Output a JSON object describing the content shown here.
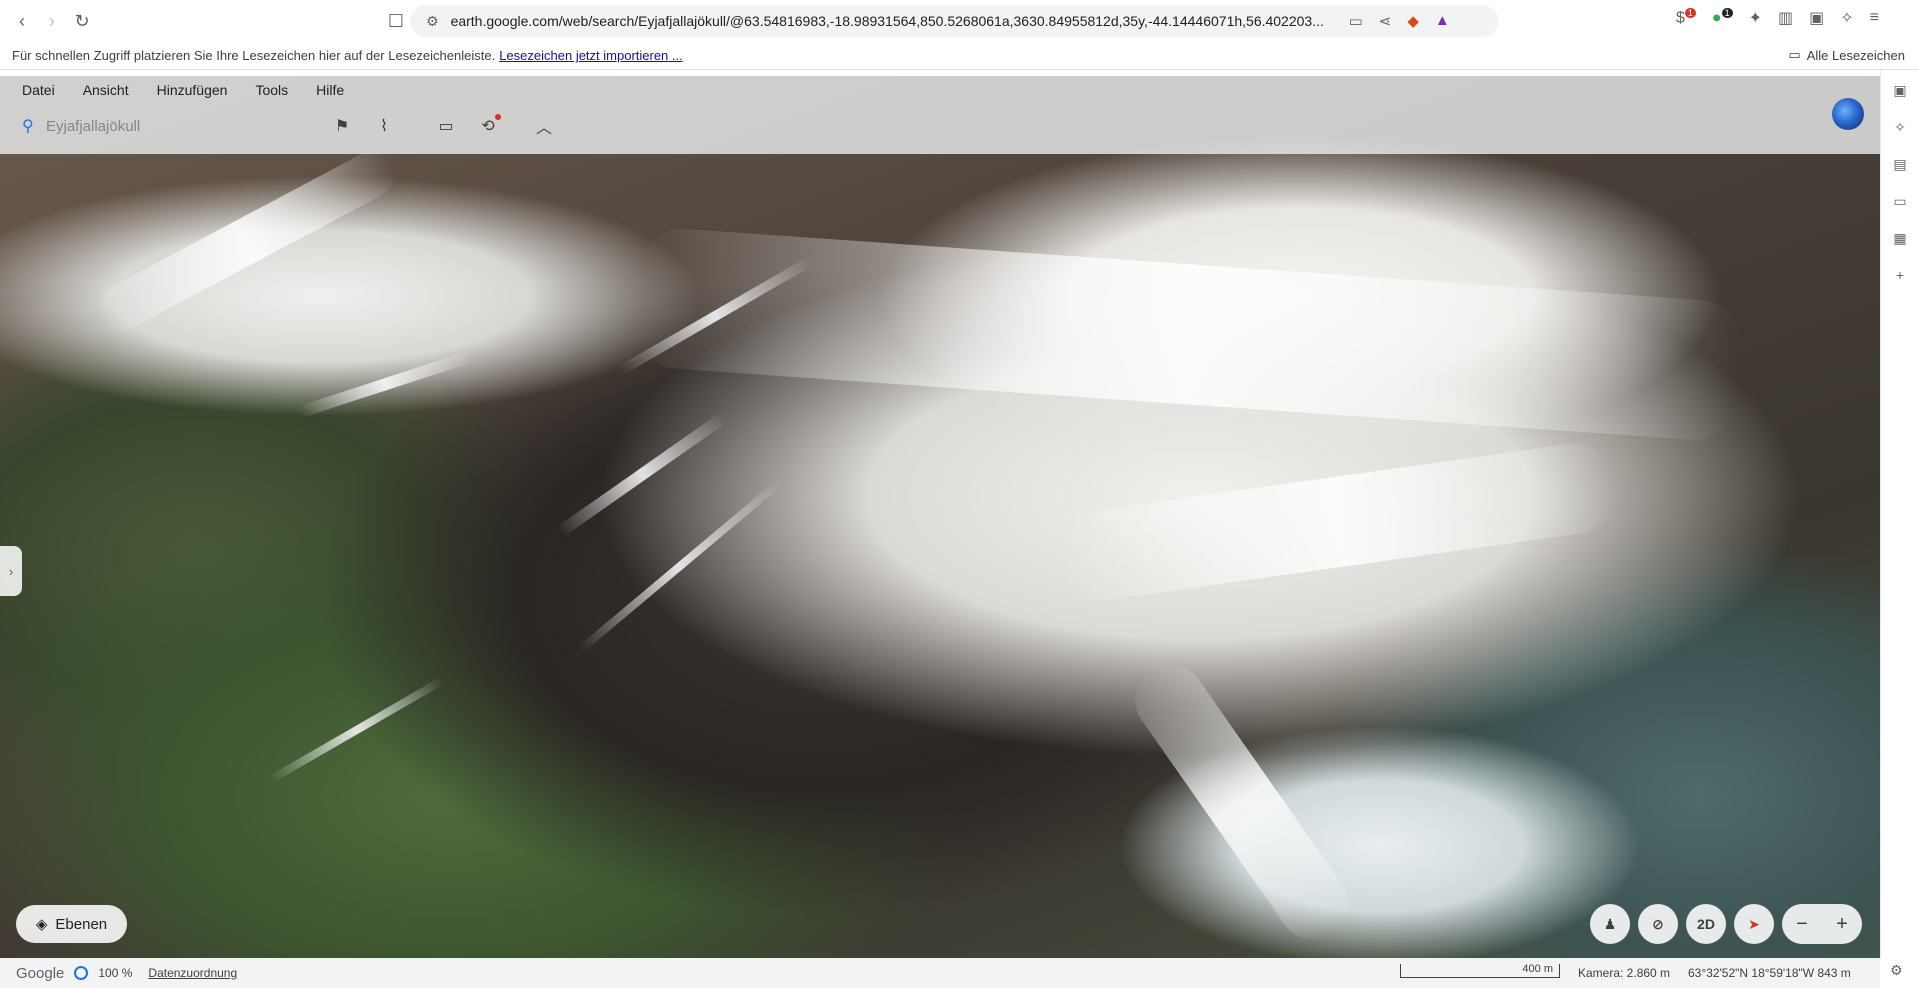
{
  "browser": {
    "url": "earth.google.com/web/search/Eyjafjallajökull/@63.54816983,-18.98931564,850.5268061a,3630.84955812d,35y,-44.14446071h,56.402203...",
    "ext_badge_1": "1",
    "ext_badge_2": "1"
  },
  "bookmarks": {
    "hint": "Für schnellen Zugriff platzieren Sie Ihre Lesezeichen hier auf der Lesezeichenleiste.",
    "import_link": "Lesezeichen jetzt importieren ...",
    "all": "Alle Lesezeichen"
  },
  "menu": {
    "items": [
      "Datei",
      "Ansicht",
      "Hinzufügen",
      "Tools",
      "Hilfe"
    ]
  },
  "search": {
    "value": "Eyjafjallajökull"
  },
  "controls": {
    "layers": "Ebenen",
    "mode_2d": "2D",
    "zoom_out": "−",
    "zoom_in": "+"
  },
  "status": {
    "brand": "Google",
    "percent": "100 %",
    "data_attribution": "Datenzuordnung",
    "scale": "400 m",
    "camera": "Kamera: 2.860 m",
    "coords": "63°32'52\"N 18°59'18\"W  843 m"
  },
  "icons": [
    "back-icon",
    "forward-icon",
    "reload-icon",
    "bookmark-star-icon",
    "site-info-icon",
    "cast-icon",
    "share-icon",
    "brave-shield-icon",
    "rewards-icon",
    "extension-icon",
    "sidebar-icon",
    "wallet-icon",
    "leo-icon",
    "folder-icon",
    "search-icon",
    "placemark-icon",
    "path-icon",
    "ruler-icon",
    "history-icon",
    "chevron-up-icon",
    "globe-icon",
    "layers-icon",
    "pegman-icon",
    "location-off-icon",
    "compass-icon",
    "chevron-right-icon",
    "settings-icon"
  ]
}
